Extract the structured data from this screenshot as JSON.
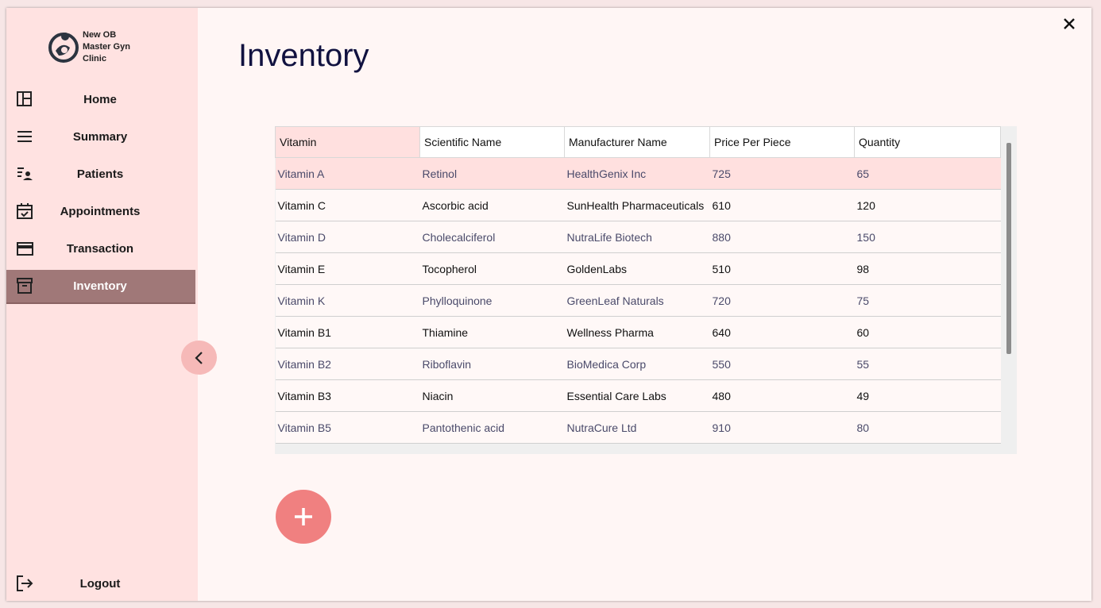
{
  "app": {
    "logo_text": [
      "New OB",
      "Master Gyn",
      "Clinic"
    ]
  },
  "sidebar": {
    "items": [
      {
        "label": "Home",
        "icon": "dashboard-icon"
      },
      {
        "label": "Summary",
        "icon": "menu-lines-icon"
      },
      {
        "label": "Patients",
        "icon": "patient-list-icon"
      },
      {
        "label": "Appointments",
        "icon": "calendar-check-icon"
      },
      {
        "label": "Transaction",
        "icon": "credit-card-icon"
      },
      {
        "label": "Inventory",
        "icon": "archive-box-icon",
        "active": true
      }
    ],
    "logout_label": "Logout"
  },
  "main": {
    "title": "Inventory"
  },
  "table": {
    "columns": [
      "Vitamin",
      "Scientific Name",
      "Manufacturer Name",
      "Price Per Piece",
      "Quantity"
    ],
    "rows": [
      [
        "Vitamin A",
        "Retinol",
        "HealthGenix Inc",
        "725",
        "65"
      ],
      [
        "Vitamin C",
        "Ascorbic acid",
        "SunHealth Pharmaceuticals",
        "610",
        "120"
      ],
      [
        "Vitamin D",
        "Cholecalciferol",
        "NutraLife Biotech",
        "880",
        "150"
      ],
      [
        "Vitamin E",
        "Tocopherol",
        "GoldenLabs",
        "510",
        "98"
      ],
      [
        "Vitamin K",
        "Phylloquinone",
        "GreenLeaf Naturals",
        "720",
        "75"
      ],
      [
        "Vitamin B1",
        "Thiamine",
        "Wellness Pharma",
        "640",
        "60"
      ],
      [
        "Vitamin B2",
        "Riboflavin",
        "BioMedica Corp",
        "550",
        "55"
      ],
      [
        "Vitamin B3",
        "Niacin",
        "Essential Care Labs",
        "480",
        "49"
      ],
      [
        "Vitamin B5",
        "Pantothenic acid",
        "NutraCure Ltd",
        "910",
        "80"
      ]
    ]
  },
  "colors": {
    "sidebar_bg": "#ffe2e1",
    "active_bg": "#a07878",
    "fab": "#f08080",
    "title": "#111240"
  }
}
